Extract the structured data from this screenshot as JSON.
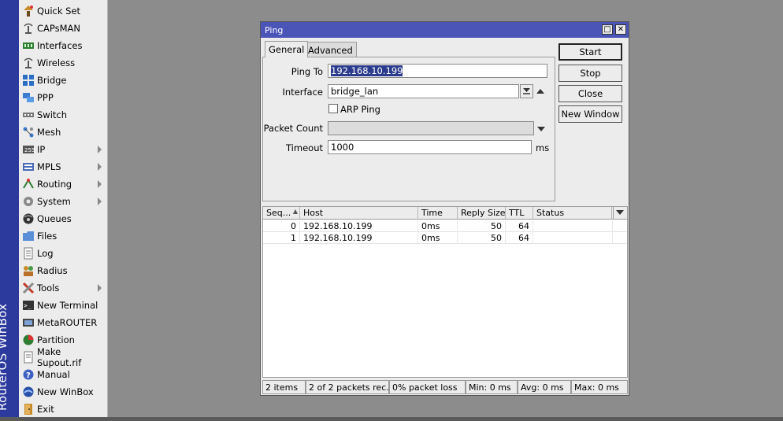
{
  "brand": {
    "text": "RouterOS WinBox"
  },
  "menu": {
    "items": [
      {
        "label": "Quick Set",
        "icon": "quickset-icon",
        "submenu": false
      },
      {
        "label": "CAPsMAN",
        "icon": "capsman-icon",
        "submenu": false
      },
      {
        "label": "Interfaces",
        "icon": "interfaces-icon",
        "submenu": false
      },
      {
        "label": "Wireless",
        "icon": "wireless-icon",
        "submenu": false
      },
      {
        "label": "Bridge",
        "icon": "bridge-icon",
        "submenu": false
      },
      {
        "label": "PPP",
        "icon": "ppp-icon",
        "submenu": false
      },
      {
        "label": "Switch",
        "icon": "switch-icon",
        "submenu": false
      },
      {
        "label": "Mesh",
        "icon": "mesh-icon",
        "submenu": false
      },
      {
        "label": "IP",
        "icon": "ip-icon",
        "submenu": true
      },
      {
        "label": "MPLS",
        "icon": "mpls-icon",
        "submenu": true
      },
      {
        "label": "Routing",
        "icon": "routing-icon",
        "submenu": true
      },
      {
        "label": "System",
        "icon": "system-icon",
        "submenu": true
      },
      {
        "label": "Queues",
        "icon": "queues-icon",
        "submenu": false
      },
      {
        "label": "Files",
        "icon": "files-icon",
        "submenu": false
      },
      {
        "label": "Log",
        "icon": "log-icon",
        "submenu": false
      },
      {
        "label": "Radius",
        "icon": "radius-icon",
        "submenu": false
      },
      {
        "label": "Tools",
        "icon": "tools-icon",
        "submenu": true
      },
      {
        "label": "New Terminal",
        "icon": "terminal-icon",
        "submenu": false
      },
      {
        "label": "MetaROUTER",
        "icon": "metarouter-icon",
        "submenu": false
      },
      {
        "label": "Partition",
        "icon": "partition-icon",
        "submenu": false
      },
      {
        "label": "Make Supout.rif",
        "icon": "supout-icon",
        "submenu": false
      },
      {
        "label": "Manual",
        "icon": "manual-icon",
        "submenu": false
      },
      {
        "label": "New WinBox",
        "icon": "winbox-icon",
        "submenu": false
      },
      {
        "label": "Exit",
        "icon": "exit-icon",
        "submenu": false
      }
    ]
  },
  "window": {
    "title": "Ping",
    "maximize_glyph": "□",
    "close_glyph": "✕",
    "tabs": [
      {
        "label": "General",
        "active": true
      },
      {
        "label": "Advanced",
        "active": false
      }
    ],
    "form": {
      "ping_to_label": "Ping To",
      "ping_to_value": "192.168.10.199",
      "interface_label": "Interface",
      "interface_value": "bridge_lan",
      "arp_ping_label": "ARP Ping",
      "arp_ping_checked": false,
      "packet_count_label": "Packet Count",
      "packet_count_value": "",
      "timeout_label": "Timeout",
      "timeout_value": "1000",
      "timeout_unit": "ms"
    },
    "buttons": {
      "start": "Start",
      "stop": "Stop",
      "close": "Close",
      "new_window": "New Window"
    },
    "table": {
      "columns": [
        "Seq...",
        "Host",
        "Time",
        "Reply Size",
        "TTL",
        "Status"
      ],
      "rows": [
        {
          "seq": "0",
          "host": "192.168.10.199",
          "time": "0ms",
          "reply_size": "50",
          "ttl": "64",
          "status": ""
        },
        {
          "seq": "1",
          "host": "192.168.10.199",
          "time": "0ms",
          "reply_size": "50",
          "ttl": "64",
          "status": ""
        }
      ]
    },
    "status": {
      "items": "2 items",
      "packets": "2 of 2 packets rec...",
      "loss": "0% packet loss",
      "min": "Min: 0 ms",
      "avg": "Avg: 0 ms",
      "max": "Max: 0 ms"
    }
  }
}
